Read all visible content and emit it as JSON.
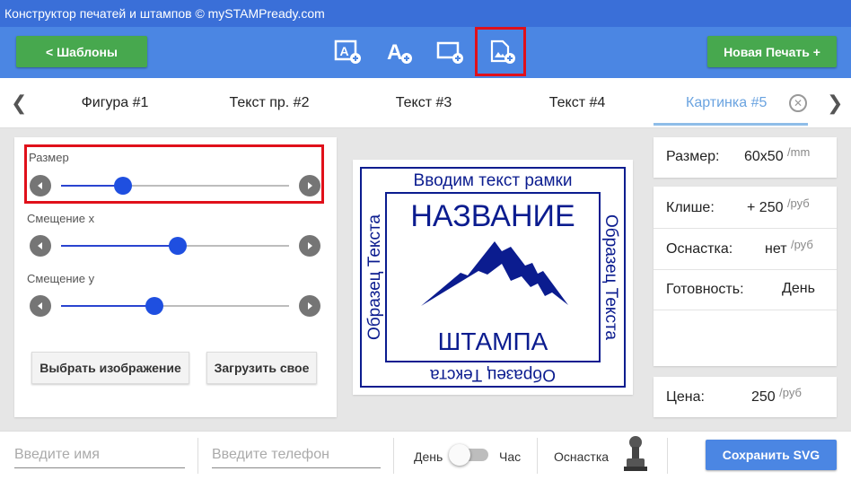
{
  "window": {
    "title": "Конструктор печатей и штампов © mySTAMPready.com"
  },
  "toolbar": {
    "templates_label": "<  Шаблоны",
    "new_stamp_label": "Новая Печать +",
    "tools": [
      "add-frame-text-icon",
      "add-text-icon",
      "add-shape-icon",
      "add-image-icon"
    ]
  },
  "tabs": {
    "items": [
      "Фигура #1",
      "Текст пр. #2",
      "Текст #3",
      "Текст #4",
      "Картинка #5"
    ],
    "active_index": 4
  },
  "image_panel": {
    "size_label": "Размер",
    "offset_x_label": "Смещение x",
    "offset_y_label": "Смещение y",
    "size_level": 0.27,
    "offset_x_level": 0.51,
    "offset_y_level": 0.41,
    "choose_image_label": "Выбрать изображение",
    "upload_label": "Загрузить свое"
  },
  "stamp": {
    "frame_text_top": "Вводим текст рамки",
    "side_left": "Образец Текста",
    "side_right": "Образец Текста",
    "bottom_text": "Образец Текста",
    "title": "НАЗВАНИЕ",
    "subtitle": "ШТАМПА",
    "ink_color": "#0b1c8f"
  },
  "info": {
    "size_label": "Размер:",
    "size_value": "60x50",
    "size_unit": "/mm",
    "cliche_label": "Клише:",
    "cliche_value": "+ 250",
    "cliche_unit": "/руб",
    "mount_label": "Оснастка:",
    "mount_value": "нет",
    "mount_unit": "/руб",
    "ready_label": "Готовность:",
    "ready_value": "День",
    "price_label": "Цена:",
    "price_value": "250",
    "price_unit": "/руб"
  },
  "bottom": {
    "name_placeholder": "Введите имя",
    "phone_placeholder": "Введите телефон",
    "toggle_left": "День",
    "toggle_right": "Час",
    "mount_label": "Оснастка",
    "save_label": "Сохранить SVG"
  },
  "colors": {
    "accent": "#4b86e3",
    "green": "#47a84e",
    "highlight": "#e0101a"
  }
}
